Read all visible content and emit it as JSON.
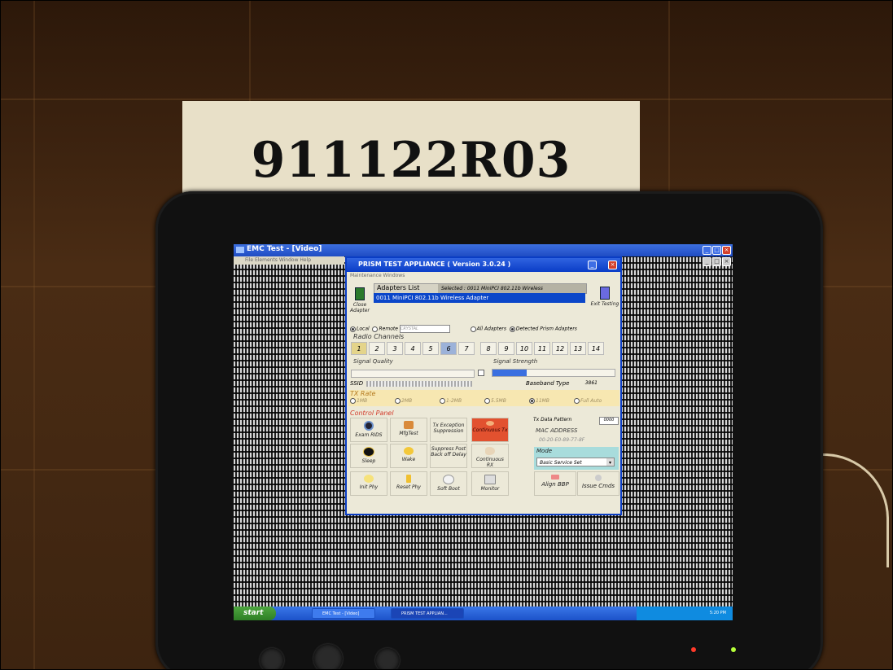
{
  "sign": {
    "text": "911122R03"
  },
  "outer_window": {
    "title": "EMC Test - [Video]",
    "menu": "File  Elements  Window  Help"
  },
  "dialog": {
    "title": "PRISM TEST APPLIANCE   ( Version 3.0.24 )",
    "subtitle": "Maintenance Windows",
    "close_adapter_label": "Close Adapter",
    "exit_label": "Exit Testing",
    "adapters_list_label": "Adapters List",
    "selected_text": "Selected : 0011     MiniPCI 802.11b Wireless",
    "adapter_row": "0011    MiniPCI 802.11b Wireless Adapter",
    "local_label": "Local",
    "remote_label": "Remote",
    "remote_value": "CRYSTAL",
    "all_adapters_label": "All Adapters",
    "detected_label": "Detected Prism Adapters",
    "radio_channels_label": "Radio Channels",
    "channels": [
      "1",
      "2",
      "3",
      "4",
      "5",
      "6",
      "7",
      "8",
      "9",
      "10",
      "11",
      "12",
      "13",
      "14"
    ],
    "selected_channel": "6",
    "signal_quality_label": "Signal Quality",
    "signal_strength_label": "Signal Strength",
    "signal_strength_level": 0.28,
    "ssid_label": "SSID",
    "baseband_label": "Baseband Type",
    "baseband_value": "3861",
    "tx_rate_label": "TX Rate",
    "tx_rates": [
      "1MB",
      "2MB",
      "1-2MB",
      "5.5MB",
      "11MB",
      "Full Auto"
    ],
    "tx_rate_selected": "11MB",
    "control_panel_label": "Control Panel",
    "buttons": {
      "exam_rids": "Exam RIDS",
      "mfg_test": "MfgTest",
      "tx_exception": "Tx Exception Suppression",
      "continuous_tx": "Continuous Tx",
      "sleep": "Sleep",
      "wake": "Wake",
      "suppress_post": "Suppress Post Back off Delay",
      "continuous_rx": "Continuous RX",
      "init_phy": "Init Phy",
      "reset_phy": "Reset Phy",
      "soft_boot": "Soft Boot",
      "monitor": "Monitor",
      "align_bbp": "Align BBP",
      "issue_cmds": "Issue Cmds"
    },
    "tx_data_pattern_label": "Tx Data Pattern",
    "tx_data_pattern_value": "0000",
    "mac_address_label": "MAC ADDRESS",
    "mac_address_value": "00-20-E0-89-77-8F",
    "mode_label": "Mode",
    "mode_value": "Basic Service Set"
  },
  "taskbar": {
    "start_label": "start",
    "tasks": [
      "EMC Test - [Video]",
      "PRISM TEST APPLIAN..."
    ],
    "clock": "5:20 PM"
  },
  "colors": {
    "title_blue": "#1f4cc3",
    "continuous_tx_red": "#e2512f",
    "tx_rate_bg": "#f7e7b1",
    "mode_bg": "#a8dcdc"
  }
}
